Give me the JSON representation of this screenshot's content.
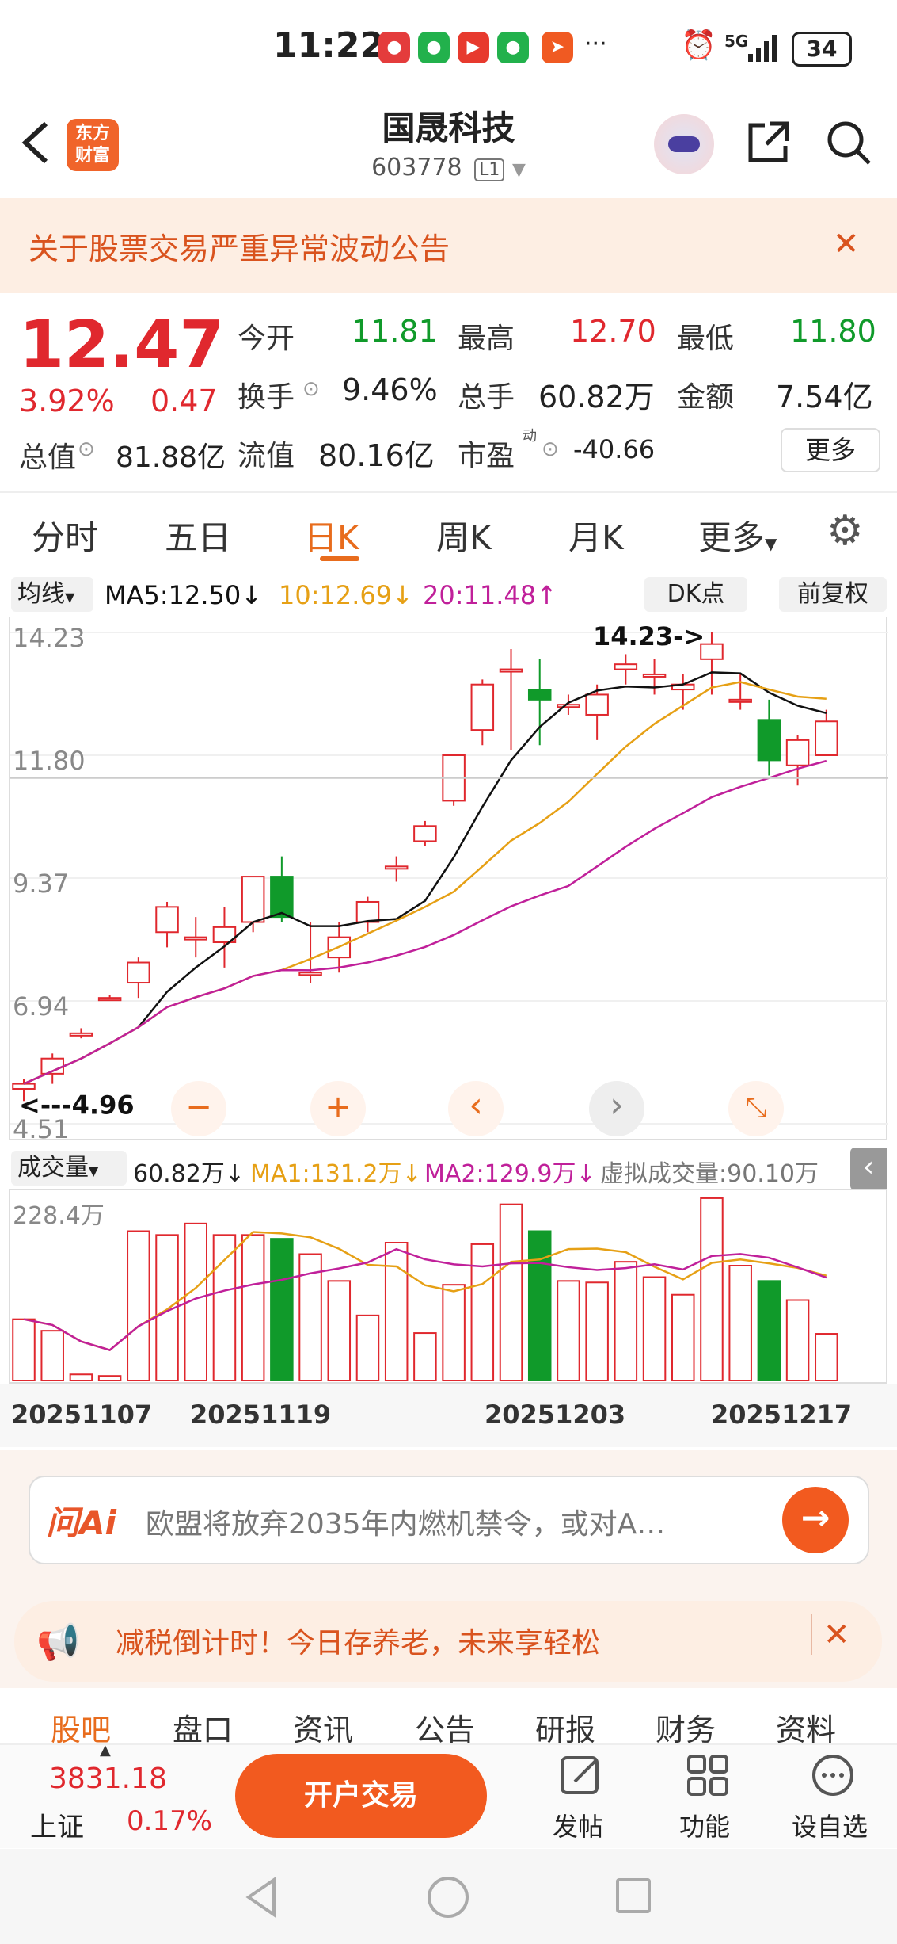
{
  "status_bar": {
    "time": "11:22",
    "network": "5G",
    "battery": "34"
  },
  "header": {
    "brand": "东方\n财富",
    "title": "国晟科技",
    "code": "603778",
    "level": "L1"
  },
  "notice": {
    "text": "关于股票交易严重异常波动公告"
  },
  "quote": {
    "price": "12.47",
    "change_pct": "3.92%",
    "change": "0.47",
    "open_label": "今开",
    "open": "11.81",
    "high_label": "最高",
    "high": "12.70",
    "low_label": "最低",
    "low": "11.80",
    "turnover_label": "换手",
    "turnover": "9.46%",
    "volume_label": "总手",
    "volume": "60.82万",
    "amount_label": "金额",
    "amount": "7.54亿",
    "mktcap_label": "总值",
    "mktcap": "81.88亿",
    "float_label": "流值",
    "float": "80.16亿",
    "pe_label": "市盈",
    "pe_sup": "动",
    "pe": "-40.66",
    "more": "更多"
  },
  "ktabs": [
    "分时",
    "五日",
    "日K",
    "周K",
    "月K",
    "更多"
  ],
  "chart_legend": {
    "ma_btn": "均线",
    "ma5": "MA5:12.50↓",
    "ma10": "10:12.69↓",
    "ma20": "20:11.48↑",
    "dk": "DK点",
    "adjust": "前复权"
  },
  "vol_legend": {
    "vol_btn": "成交量",
    "vol": "60.82万↓",
    "ma1": "MA1:131.2万↓",
    "ma2": "MA2:129.9万↓",
    "virtual": "虚拟成交量:90.10万"
  },
  "chart_data": {
    "type": "candlestick",
    "y_ticks": [
      "14.23",
      "11.80",
      "9.37",
      "6.94",
      "4.51"
    ],
    "ylim": [
      4.51,
      14.23
    ],
    "annotations": [
      "14.23->",
      "<---4.96"
    ],
    "vol_tick": "228.4万",
    "x_ticks": [
      "20251107",
      "20251119",
      "20251203",
      "20251217"
    ],
    "candles": [
      {
        "o": 5.2,
        "h": 5.4,
        "l": 4.96,
        "c": 5.3,
        "v": 80
      },
      {
        "o": 5.5,
        "h": 5.9,
        "l": 5.3,
        "c": 5.8,
        "v": 65
      },
      {
        "o": 6.3,
        "h": 6.4,
        "l": 6.2,
        "c": 6.3,
        "v": 8
      },
      {
        "o": 7.0,
        "h": 7.05,
        "l": 6.95,
        "c": 7.0,
        "v": 6
      },
      {
        "o": 7.3,
        "h": 7.8,
        "l": 7.0,
        "c": 7.7,
        "v": 195
      },
      {
        "o": 8.3,
        "h": 8.9,
        "l": 8.0,
        "c": 8.8,
        "v": 190
      },
      {
        "o": 8.2,
        "h": 8.6,
        "l": 7.8,
        "c": 8.2,
        "v": 205
      },
      {
        "o": 8.1,
        "h": 8.8,
        "l": 7.6,
        "c": 8.4,
        "v": 190
      },
      {
        "o": 8.5,
        "h": 9.4,
        "l": 8.3,
        "c": 9.4,
        "v": 190
      },
      {
        "o": 9.4,
        "h": 9.8,
        "l": 8.5,
        "c": 8.6,
        "v": 185
      },
      {
        "o": 7.5,
        "h": 8.5,
        "l": 7.3,
        "c": 7.5,
        "v": 165
      },
      {
        "o": 7.8,
        "h": 8.5,
        "l": 7.5,
        "c": 8.2,
        "v": 130
      },
      {
        "o": 8.5,
        "h": 9.0,
        "l": 8.3,
        "c": 8.9,
        "v": 85
      },
      {
        "o": 9.6,
        "h": 9.8,
        "l": 9.3,
        "c": 9.6,
        "v": 180
      },
      {
        "o": 10.1,
        "h": 10.5,
        "l": 10.0,
        "c": 10.4,
        "v": 62
      },
      {
        "o": 10.9,
        "h": 11.8,
        "l": 10.8,
        "c": 11.8,
        "v": 125
      },
      {
        "o": 12.3,
        "h": 13.3,
        "l": 12.0,
        "c": 13.2,
        "v": 178
      },
      {
        "o": 13.5,
        "h": 13.9,
        "l": 11.9,
        "c": 13.5,
        "v": 230
      },
      {
        "o": 13.1,
        "h": 13.7,
        "l": 12.0,
        "c": 12.9,
        "v": 195
      },
      {
        "o": 12.8,
        "h": 13.0,
        "l": 12.6,
        "c": 12.8,
        "v": 130
      },
      {
        "o": 12.6,
        "h": 13.2,
        "l": 12.1,
        "c": 13.0,
        "v": 128
      },
      {
        "o": 13.5,
        "h": 13.8,
        "l": 13.2,
        "c": 13.6,
        "v": 155
      },
      {
        "o": 13.4,
        "h": 13.7,
        "l": 13.0,
        "c": 13.4,
        "v": 135
      },
      {
        "o": 13.1,
        "h": 13.4,
        "l": 12.7,
        "c": 13.2,
        "v": 112
      },
      {
        "o": 13.7,
        "h": 14.23,
        "l": 13.0,
        "c": 14.0,
        "v": 238
      },
      {
        "o": 12.9,
        "h": 13.4,
        "l": 12.7,
        "c": 12.9,
        "v": 150
      },
      {
        "o": 12.5,
        "h": 12.9,
        "l": 11.4,
        "c": 11.7,
        "v": 130
      },
      {
        "o": 11.6,
        "h": 12.2,
        "l": 11.2,
        "c": 12.1,
        "v": 105
      },
      {
        "o": 11.8,
        "h": 12.7,
        "l": 11.8,
        "c": 12.47,
        "v": 61
      }
    ]
  },
  "chart_controls": [
    "−",
    "+",
    "‹",
    "›",
    "⤡"
  ],
  "ai": {
    "badge": "问Ai",
    "text": "欧盟将放弃2035年内燃机禁令，或对A…",
    "go": "→"
  },
  "ad": {
    "text": "减税倒计时！今日存养老，未来享轻松"
  },
  "bottom_tabs": [
    "股吧",
    "盘口",
    "资讯",
    "公告",
    "研报",
    "财务",
    "资料"
  ],
  "index": {
    "value": "3831.18",
    "name": "上证",
    "pct": "0.17%"
  },
  "trade": "开户交易",
  "actions": {
    "post": "发帖",
    "func": "功能",
    "watch": "设自选"
  },
  "colors": {
    "up": "#e0282e",
    "down": "#109a2a",
    "accent": "#e86c1d",
    "ma5": "#111111",
    "ma10": "#e6a015",
    "ma20": "#c0209a"
  }
}
